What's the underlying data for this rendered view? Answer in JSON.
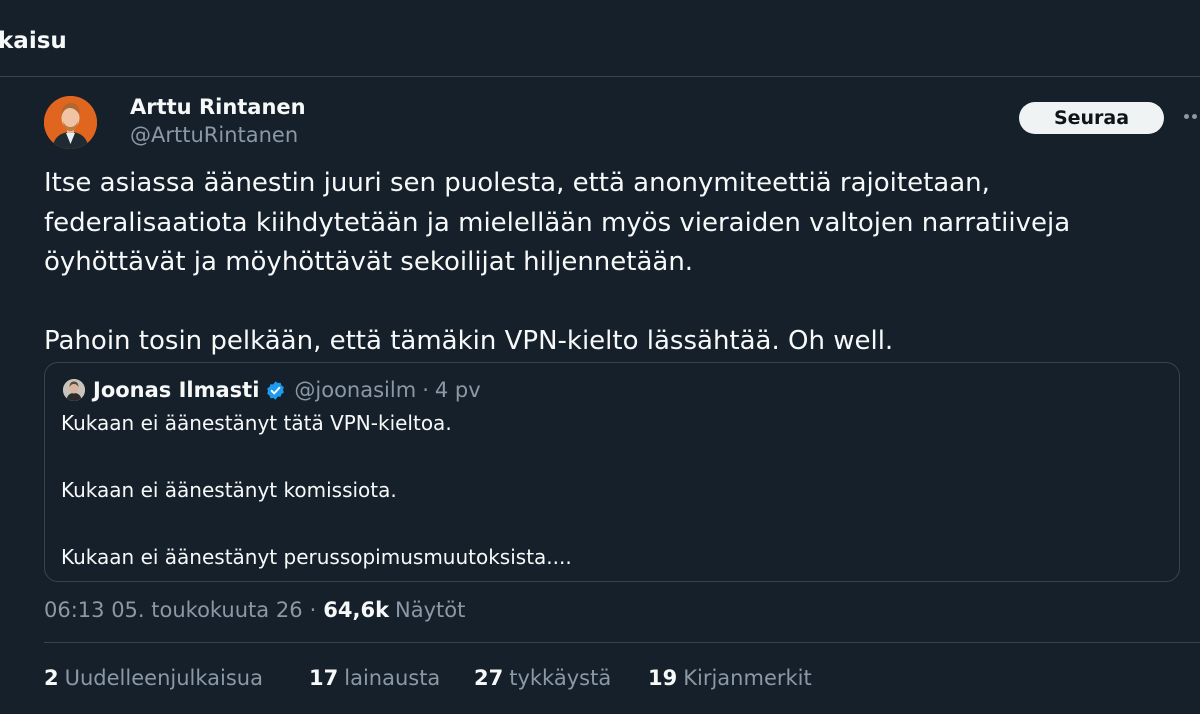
{
  "header": {
    "title": "kaisu"
  },
  "tweet": {
    "author_name": "Arttu Rintanen",
    "author_handle": "@ArttuRintanen",
    "follow_label": "Seuraa",
    "paragraphs": [
      "Itse asiassa äänestin juuri sen puolesta, että anonymiteettiä rajoitetaan,\nfederalisaatiota kiihdytetään ja mielellään myös vieraiden valtojen narratiiveja\nöyhöttävät ja möyhöttävät sekoilijat hiljennetään.",
      "Pahoin tosin pelkään, että tämäkin VPN-kielto lässähtää. Oh well."
    ],
    "quote": {
      "name": "Joonas Ilmasti",
      "handle": "@joonasilm",
      "separator": "·",
      "time": "4 pv",
      "lines": [
        "Kukaan ei äänestänyt tätä VPN-kieltoa.",
        "Kukaan ei äänestänyt komissiota.",
        "Kukaan ei äänestänyt perussopimusmuutoksista...."
      ]
    },
    "meta": {
      "timestamp": "06:13 05. toukokuuta 26",
      "separator": "·",
      "views_count": "64,6k",
      "views_label": "Näytöt"
    },
    "stats": [
      {
        "count": "2",
        "label": "Uudelleenjulkaisua"
      },
      {
        "count": "17",
        "label": "lainausta"
      },
      {
        "count": "27",
        "label": "tykkäystä"
      },
      {
        "count": "19",
        "label": "Kirjanmerkit"
      }
    ]
  },
  "colors": {
    "background": "#15202b",
    "text_primary": "#f7f9f9",
    "text_secondary": "#8b98a5",
    "border": "#38444d",
    "verified": "#1d9bf0",
    "follow_button_bg": "#eff3f4"
  },
  "icons": {
    "more": "more-horizontal-icon",
    "verified": "verified-badge-icon"
  }
}
